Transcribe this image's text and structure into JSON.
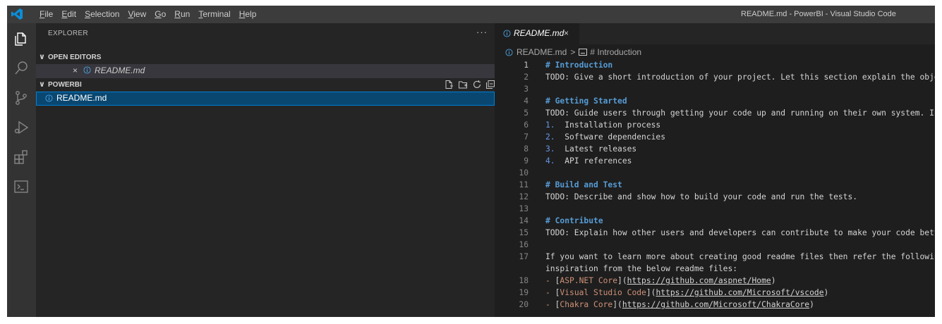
{
  "menu": [
    {
      "accel": "F",
      "rest": "ile"
    },
    {
      "accel": "E",
      "rest": "dit"
    },
    {
      "accel": "S",
      "rest": "election"
    },
    {
      "accel": "V",
      "rest": "iew"
    },
    {
      "accel": "G",
      "rest": "o"
    },
    {
      "accel": "R",
      "rest": "un"
    },
    {
      "accel": "T",
      "rest": "erminal"
    },
    {
      "accel": "H",
      "rest": "elp"
    }
  ],
  "window_title": "README.md - PowerBI - Visual Studio Code",
  "activity_icons": [
    "explorer-icon",
    "search-icon",
    "source-control-icon",
    "run-debug-icon",
    "extensions-icon",
    "terminal-icon"
  ],
  "sidebar": {
    "title": "EXPLORER",
    "more": "···",
    "open_editors_label": "OPEN EDITORS",
    "open_editor_item": "README.md",
    "open_editor_close": "×",
    "folder_label": "POWERBI",
    "file": "README.md"
  },
  "editor": {
    "tab_label": "README.md",
    "tab_close": "×",
    "breadcrumb": {
      "file": "README.md",
      "separator": ">",
      "symbol": "# Introduction"
    }
  },
  "code_lines": [
    {
      "n": "1",
      "segs": [
        {
          "t": "# Introduction",
          "c": "h"
        }
      ]
    },
    {
      "n": "2",
      "segs": [
        {
          "t": "TODO: Give a short introduction of your project. Let this section explain the obje"
        }
      ]
    },
    {
      "n": "3",
      "segs": []
    },
    {
      "n": "4",
      "segs": [
        {
          "t": "# Getting Started",
          "c": "h"
        }
      ]
    },
    {
      "n": "5",
      "segs": [
        {
          "t": "TODO: Guide users through getting your code up and running on their own system. In"
        }
      ]
    },
    {
      "n": "6",
      "segs": [
        {
          "t": "1.",
          "c": "num"
        },
        {
          "t": "  Installation process"
        }
      ]
    },
    {
      "n": "7",
      "segs": [
        {
          "t": "2.",
          "c": "num"
        },
        {
          "t": "  Software dependencies"
        }
      ]
    },
    {
      "n": "8",
      "segs": [
        {
          "t": "3.",
          "c": "num"
        },
        {
          "t": "  Latest releases"
        }
      ]
    },
    {
      "n": "9",
      "segs": [
        {
          "t": "4.",
          "c": "num"
        },
        {
          "t": "  API references"
        }
      ]
    },
    {
      "n": "10",
      "segs": []
    },
    {
      "n": "11",
      "segs": [
        {
          "t": "# Build and Test",
          "c": "h"
        }
      ]
    },
    {
      "n": "12",
      "segs": [
        {
          "t": "TODO: Describe and show how to build your code and run the tests."
        }
      ]
    },
    {
      "n": "13",
      "segs": []
    },
    {
      "n": "14",
      "segs": [
        {
          "t": "# Contribute",
          "c": "h"
        }
      ]
    },
    {
      "n": "15",
      "segs": [
        {
          "t": "TODO: Explain how other users and developers can contribute to make your code bett"
        }
      ]
    },
    {
      "n": "16",
      "segs": []
    },
    {
      "n": "17",
      "segs": [
        {
          "t": "If you want to learn more about creating good readme files then refer the followin"
        }
      ]
    },
    {
      "n": "",
      "segs": [
        {
          "t": "inspiration from the below readme files:"
        }
      ]
    },
    {
      "n": "18",
      "segs": [
        {
          "t": "- ",
          "c": "lnk"
        },
        {
          "t": "["
        },
        {
          "t": "ASP.NET Core",
          "c": "lnk"
        },
        {
          "t": "]("
        },
        {
          "t": "https://github.com/aspnet/Home",
          "c": "url"
        },
        {
          "t": ")"
        }
      ]
    },
    {
      "n": "19",
      "segs": [
        {
          "t": "- ",
          "c": "lnk"
        },
        {
          "t": "["
        },
        {
          "t": "Visual Studio Code",
          "c": "lnk"
        },
        {
          "t": "]("
        },
        {
          "t": "https://github.com/Microsoft/vscode",
          "c": "url"
        },
        {
          "t": ")"
        }
      ]
    },
    {
      "n": "20",
      "segs": [
        {
          "t": "- ",
          "c": "lnk"
        },
        {
          "t": "["
        },
        {
          "t": "Chakra Core",
          "c": "lnk"
        },
        {
          "t": "]("
        },
        {
          "t": "https://github.com/Microsoft/ChakraCore",
          "c": "url"
        },
        {
          "t": ")"
        }
      ]
    }
  ],
  "colors": {
    "heading": "#569cd6",
    "list_number": "#6796e6",
    "link_text": "#ce9178",
    "selection": "#094771",
    "focus_border": "#007fd4"
  }
}
